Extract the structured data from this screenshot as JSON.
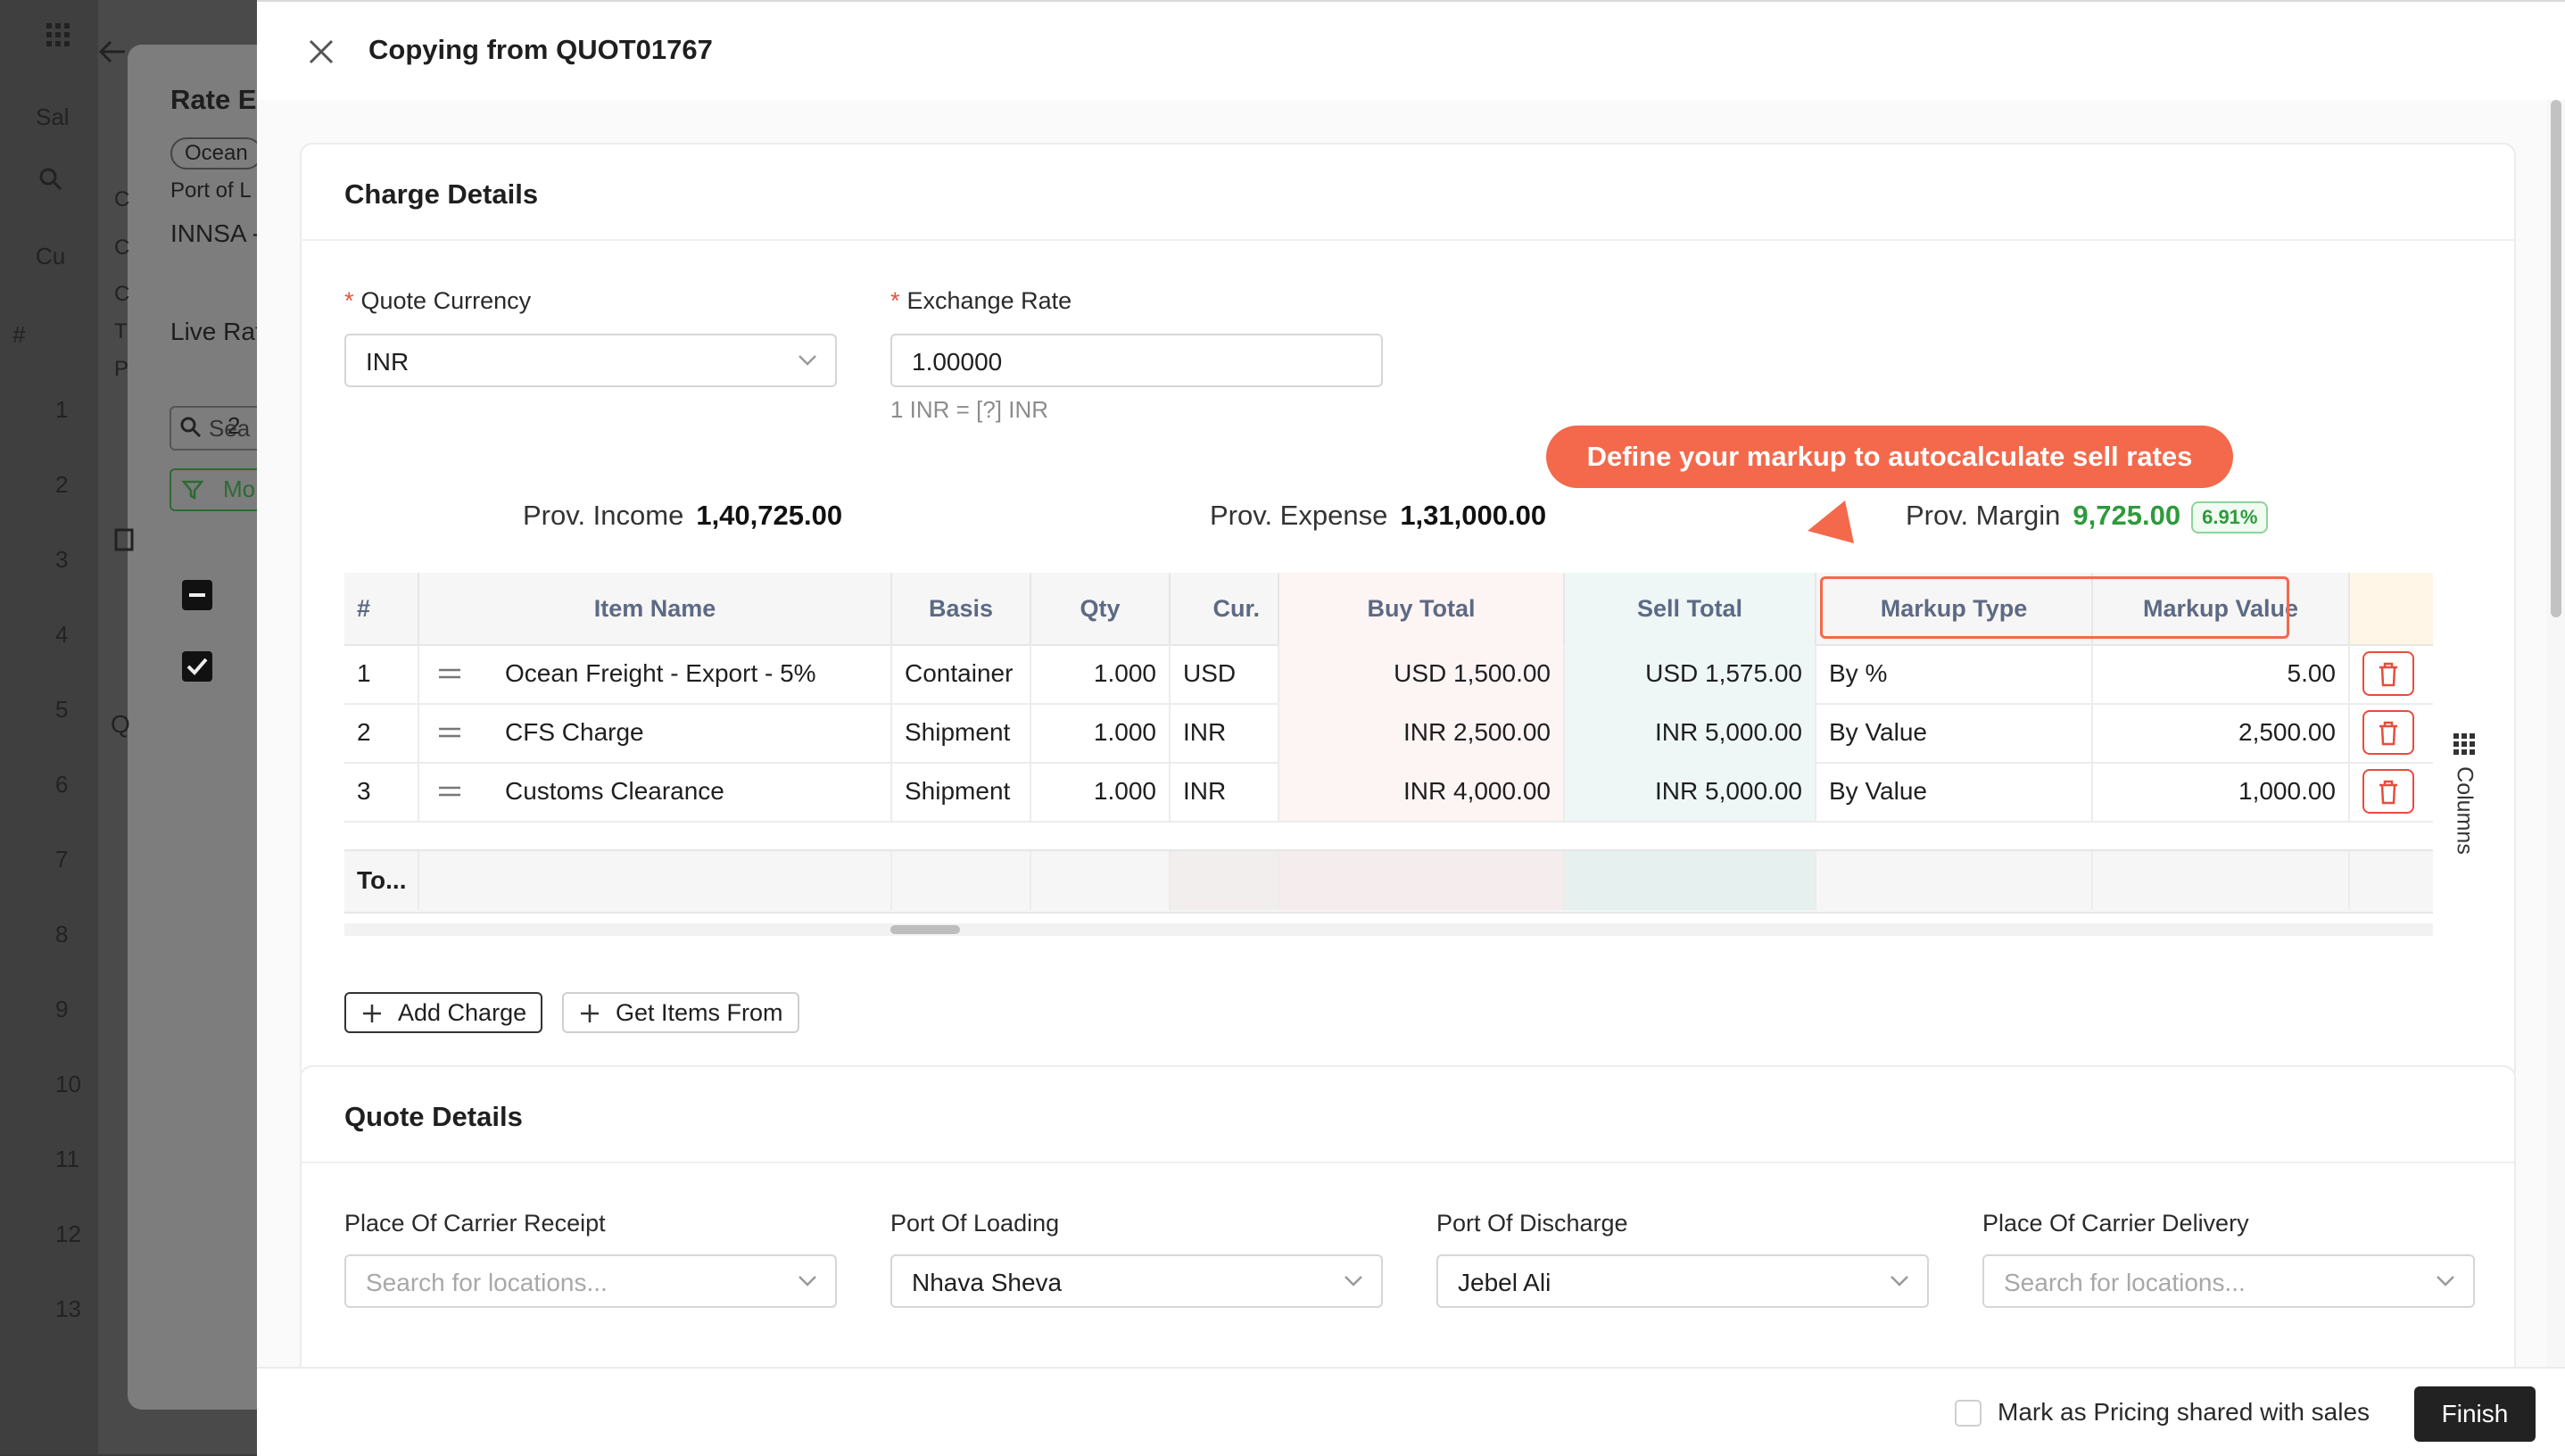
{
  "background": {
    "rail_numbers": [
      "#",
      "1",
      "2",
      "3",
      "4",
      "5",
      "6",
      "7",
      "8",
      "9",
      "10",
      "11",
      "12",
      "13"
    ],
    "panel_title": "Rate E",
    "chip": "Ocean",
    "port_label": "Port of L",
    "port_value": "INNSA -",
    "live_rates": "Live Rat",
    "search_placeholder": "Sea",
    "filter_label": "Mo",
    "row_number": "2",
    "side_letters": [
      "C",
      "C",
      "C",
      "T",
      "P"
    ],
    "header_fragment_1": "Sal",
    "header_fragment_2": "Cu",
    "section_initial": "Q"
  },
  "drawer": {
    "title": "Copying from QUOT01767"
  },
  "charge_details": {
    "title": "Charge Details",
    "quote_currency_label": "Quote Currency",
    "quote_currency_value": "INR",
    "exchange_rate_label": "Exchange Rate",
    "exchange_rate_value": "1.00000",
    "exchange_hint": "1 INR = [?] INR",
    "tooltip": "Define your markup to autocalculate sell rates",
    "prov_income_label": "Prov. Income",
    "prov_income_value": "1,40,725.00",
    "prov_expense_label": "Prov. Expense",
    "prov_expense_value": "1,31,000.00",
    "prov_margin_label": "Prov. Margin",
    "prov_margin_value": "9,725.00",
    "prov_margin_pct": "6.91%",
    "table": {
      "headers": {
        "num": "#",
        "item_name": "Item Name",
        "basis": "Basis",
        "qty": "Qty",
        "cur": "Cur.",
        "buy_total": "Buy Total",
        "sell_total": "Sell Total",
        "markup_type": "Markup Type",
        "markup_value": "Markup Value"
      },
      "rows": [
        {
          "num": "1",
          "item": "Ocean Freight - Export - 5%",
          "basis": "Container",
          "qty": "1.000",
          "cur": "USD",
          "buy": "USD 1,500.00",
          "sell": "USD 1,575.00",
          "markup_type": "By %",
          "markup_value": "5.00"
        },
        {
          "num": "2",
          "item": "CFS Charge",
          "basis": "Shipment",
          "qty": "1.000",
          "cur": "INR",
          "buy": "INR 2,500.00",
          "sell": "INR 5,000.00",
          "markup_type": "By Value",
          "markup_value": "2,500.00"
        },
        {
          "num": "3",
          "item": "Customs Clearance",
          "basis": "Shipment",
          "qty": "1.000",
          "cur": "INR",
          "buy": "INR 4,000.00",
          "sell": "INR 5,000.00",
          "markup_type": "By Value",
          "markup_value": "1,000.00"
        }
      ],
      "total_label": "To..."
    },
    "columns_label": "Columns",
    "add_charge": "Add Charge",
    "get_items_from": "Get Items From"
  },
  "quote_details": {
    "title": "Quote Details",
    "place_receipt_label": "Place Of Carrier Receipt",
    "place_receipt_placeholder": "Search for locations...",
    "port_loading_label": "Port Of Loading",
    "port_loading_value": "Nhava Sheva",
    "port_discharge_label": "Port Of Discharge",
    "port_discharge_value": "Jebel Ali",
    "place_delivery_label": "Place Of Carrier Delivery",
    "place_delivery_placeholder": "Search for locations..."
  },
  "footer": {
    "checkbox_label": "Mark as Pricing shared with sales",
    "finish": "Finish"
  },
  "colors": {
    "accent": "#f4694b",
    "margin_green": "#2e9a3c",
    "header_text": "#5d6a84",
    "delete_red": "#e74c3c"
  }
}
